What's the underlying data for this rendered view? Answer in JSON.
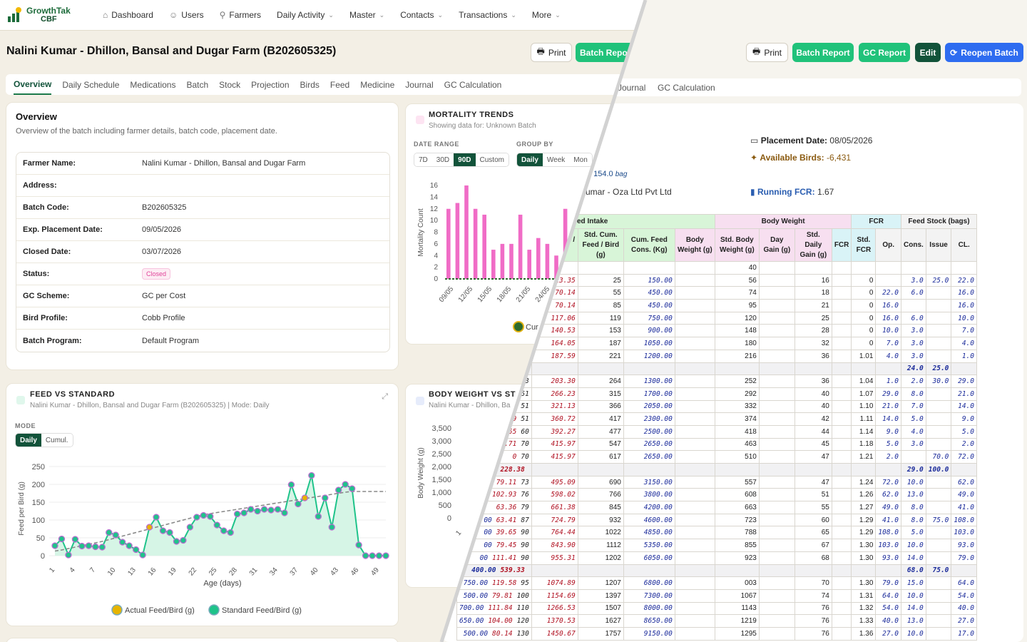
{
  "app": {
    "brand_top": "GrowthTak",
    "brand_bottom": "CBF"
  },
  "nav": [
    {
      "label": "Dashboard",
      "icon": "home-icon",
      "dropdown": false
    },
    {
      "label": "Users",
      "icon": "users-icon",
      "dropdown": false
    },
    {
      "label": "Farmers",
      "icon": "farmer-icon",
      "dropdown": false
    },
    {
      "label": "Daily Activity",
      "icon": "",
      "dropdown": true
    },
    {
      "label": "Master",
      "icon": "",
      "dropdown": true
    },
    {
      "label": "Contacts",
      "icon": "",
      "dropdown": true
    },
    {
      "label": "Transactions",
      "icon": "",
      "dropdown": true
    },
    {
      "label": "More",
      "icon": "",
      "dropdown": true
    }
  ],
  "page_title": "Nalini Kumar - Dhillon, Bansal and Dugar Farm (B202605325)",
  "buttons": {
    "print": "Print",
    "batch_report": "Batch Report",
    "batch_report_cut": "Batch Repo",
    "gc_report": "GC Report",
    "edit": "Edit",
    "reopen": "Reopen Batch"
  },
  "tabs": [
    "Overview",
    "Daily Schedule",
    "Medications",
    "Batch",
    "Stock",
    "Projection",
    "Birds",
    "Feed",
    "Medicine",
    "Journal",
    "GC Calculation"
  ],
  "right_tabs": [
    "Journal",
    "GC Calculation"
  ],
  "overview": {
    "title": "Overview",
    "subtitle": "Overview of the batch including farmer details, batch code, placement date.",
    "rows": [
      {
        "k": "Farmer Name:",
        "v": "Nalini Kumar - Dhillon, Bansal and Dugar Farm"
      },
      {
        "k": "Address:",
        "v": ""
      },
      {
        "k": "Batch Code:",
        "v": "B202605325"
      },
      {
        "k": "Exp. Placement Date:",
        "v": "09/05/2026"
      },
      {
        "k": "Closed Date:",
        "v": "03/07/2026"
      },
      {
        "k": "Status:",
        "v": "Closed"
      },
      {
        "k": "GC Scheme:",
        "v": "GC per Cost"
      },
      {
        "k": "Bird Profile:",
        "v": "Cobb Profile"
      },
      {
        "k": "Batch Program:",
        "v": "Default Program"
      }
    ]
  },
  "mortality": {
    "title": "MORTALITY TRENDS",
    "subtitle": "Showing data for: Unknown Batch",
    "date_range_label": "DATE RANGE",
    "group_by_label": "GROUP BY",
    "ranges": [
      "7D",
      "30D",
      "90D",
      "Custom"
    ],
    "groups": [
      "Daily",
      "Week",
      "Mon"
    ],
    "legend_cut": "Cur"
  },
  "feed_vs_std": {
    "title": "FEED VS STANDARD",
    "subtitle": "Nalini Kumar - Dhillon, Bansal and Dugar Farm (B202605325) | Mode: Daily",
    "mode_label": "MODE",
    "modes": [
      "Daily",
      "Cumul."
    ],
    "legend": [
      "Actual Feed/Bird (g)",
      "Standard Feed/Bird (g)"
    ]
  },
  "body_weight": {
    "title": "BODY WEIGHT VS ST",
    "subtitle": "Nalini Kumar - Dhillon, Ba"
  },
  "info": {
    "placement_label": "Placement Date:",
    "placement_value": "08/05/2026",
    "birds_label": "Available Birds:",
    "birds_value": "-6,431",
    "fcr_label": "Running FCR:",
    "fcr_value": "1.67",
    "bag_value": ": 154.0",
    "bag_unit": "bag",
    "supplier": "umar - Oza Ltd Pvt Ltd"
  },
  "chart_data": [
    {
      "type": "bar",
      "title": "MORTALITY TRENDS",
      "ylabel": "Mortality Count",
      "ylim": [
        0,
        16
      ],
      "yticks": [
        0,
        2,
        4,
        6,
        8,
        10,
        12,
        14,
        16
      ],
      "xticks": [
        "09/05",
        "12/05",
        "15/05",
        "18/05",
        "21/05",
        "24/05"
      ],
      "values": [
        12,
        13,
        16,
        12,
        11,
        5,
        6,
        6,
        11,
        5,
        7,
        6,
        4,
        12,
        7,
        6,
        9,
        9,
        8,
        13,
        6,
        8,
        12
      ],
      "color": "#f06cc6"
    },
    {
      "type": "line",
      "title": "FEED VS STANDARD",
      "xlabel": "Age (days)",
      "ylabel": "Feed per Bird (g)",
      "ylim": [
        0,
        250
      ],
      "yticks": [
        0,
        50,
        100,
        150,
        200,
        250
      ],
      "xticks": [
        "1",
        "4",
        "7",
        "10",
        "13",
        "16",
        "19",
        "22",
        "25",
        "28",
        "31",
        "34",
        "37",
        "40",
        "43",
        "46",
        "49"
      ],
      "series": [
        {
          "name": "Actual Feed/Bird (g)",
          "values": [
            28,
            47,
            2,
            46,
            27,
            28,
            25,
            24,
            65,
            58,
            38,
            28,
            17,
            2,
            80,
            108,
            70,
            65,
            40,
            43,
            80,
            108,
            113,
            110,
            86,
            70,
            65,
            117,
            120,
            130,
            125,
            130,
            128,
            130,
            120,
            199,
            145,
            162,
            225,
            110,
            162,
            80,
            184,
            200,
            188,
            30,
            0,
            0,
            0,
            0
          ]
        },
        {
          "name": "Standard Feed/Bird (g)",
          "values": [
            13,
            16,
            20,
            24,
            28,
            32,
            36,
            40,
            45,
            50,
            55,
            60,
            65,
            70,
            75,
            80,
            85,
            90,
            95,
            100,
            105,
            110,
            115,
            118,
            121,
            124,
            127,
            130,
            133,
            136,
            139,
            142,
            145,
            148,
            151,
            154,
            157,
            160,
            163,
            166,
            169,
            172,
            175,
            178,
            180,
            180,
            180,
            180,
            180,
            180
          ]
        }
      ]
    },
    {
      "type": "line",
      "title": "BODY WEIGHT VS ST",
      "ylabel": "Body Weight (g)",
      "ylim": [
        0,
        3500
      ],
      "yticks": [
        0,
        500,
        1000,
        1500,
        2000,
        2500,
        3000,
        3500
      ],
      "xticks": [
        "1"
      ]
    }
  ],
  "table": {
    "groups": [
      {
        "label": "ed Intake"
      },
      {
        "label": "Body Weight"
      },
      {
        "label": "FCR"
      },
      {
        "label": "Feed Stock (bags)"
      }
    ],
    "headers": [
      "",
      "Cum. Feed / Bird (g)",
      "Std. Cum. Feed / Bird (g)",
      "Cum. Feed Cons. (Kg)",
      "Body Weight (g)",
      "Std. Body Weight (g)",
      "Day Gain (g)",
      "Std. Daily Gain (g)",
      "FCR",
      "Std. FCR",
      "Op.",
      "Cons.",
      "Issue",
      "CL."
    ],
    "rows": [
      {
        "c": [
          "",
          "",
          "",
          "",
          "",
          "40",
          "",
          "",
          "",
          "",
          "",
          "",
          "",
          ""
        ]
      },
      {
        "c": [
          "",
          "23.35",
          "25",
          "150.00",
          "",
          "56",
          "",
          "16",
          "",
          "0",
          "",
          "3.0",
          "25.0",
          "22.0"
        ]
      },
      {
        "c": [
          "30",
          "70.14",
          "55",
          "450.00",
          "",
          "74",
          "",
          "18",
          "",
          "0",
          "22.0",
          "6.0",
          "",
          "16.0"
        ]
      },
      {
        "c": [
          "30",
          "70.14",
          "85",
          "450.00",
          "",
          "95",
          "",
          "21",
          "",
          "0",
          "16.0",
          "",
          "",
          "16.0"
        ]
      },
      {
        "c": [
          "34",
          "117.06",
          "119",
          "750.00",
          "",
          "120",
          "",
          "25",
          "",
          "0",
          "16.0",
          "6.0",
          "",
          "10.0"
        ]
      },
      {
        "c": [
          "34",
          "140.53",
          "153",
          "900.00",
          "",
          "148",
          "",
          "28",
          "",
          "0",
          "10.0",
          "3.0",
          "",
          "7.0"
        ]
      },
      {
        "c": [
          "34",
          "164.05",
          "187",
          "1050.00",
          "",
          "180",
          "",
          "32",
          "",
          "0",
          "7.0",
          "3.0",
          "",
          "4.0"
        ]
      },
      {
        "c": [
          "34",
          "187.59",
          "221",
          "1200.00",
          "",
          "216",
          "",
          "36",
          "",
          "1.01",
          "4.0",
          "3.0",
          "",
          "1.0"
        ]
      },
      {
        "sub": true,
        "c": [
          "",
          "",
          "",
          "",
          "",
          "",
          "",
          "",
          "",
          "",
          "",
          "24.0",
          "25.0",
          ""
        ]
      },
      {
        "c": [
          "43",
          "203.30",
          "264",
          "1300.00",
          "",
          "252",
          "",
          "36",
          "",
          "1.04",
          "1.0",
          "2.0",
          "30.0",
          "29.0"
        ]
      },
      {
        "c": [
          "51",
          "266.23",
          "315",
          "1700.00",
          "",
          "292",
          "",
          "40",
          "",
          "1.07",
          "29.0",
          "8.0",
          "",
          "21.0"
        ]
      },
      {
        "c": [
          "51",
          "321.13",
          "366",
          "2050.00",
          "",
          "332",
          "",
          "40",
          "",
          "1.10",
          "21.0",
          "7.0",
          "",
          "14.0"
        ]
      },
      {
        "c": [
          "51",
          "360.72",
          "417",
          "2300.00",
          "",
          "374",
          "",
          "42",
          "",
          "1.11",
          "14.0",
          "5.0",
          "",
          "9.0"
        ]
      },
      {
        "c": [
          "60",
          "392.27",
          "477",
          "2500.00",
          "",
          "418",
          "",
          "44",
          "",
          "1.14",
          "9.0",
          "4.0",
          "",
          "5.0"
        ]
      },
      {
        "c": [
          "70",
          "415.97",
          "547",
          "2650.00",
          "",
          "463",
          "",
          "45",
          "",
          "1.18",
          "5.0",
          "3.0",
          "",
          "2.0"
        ]
      },
      {
        "c": [
          "70",
          "415.97",
          "617",
          "2650.00",
          "",
          "510",
          "",
          "47",
          "",
          "1.21",
          "2.0",
          "",
          "70.0",
          "72.0"
        ]
      },
      {
        "sub": true,
        "c": [
          "",
          "",
          "",
          "",
          "",
          "",
          "",
          "",
          "",
          "",
          "",
          "29.0",
          "100.0",
          ""
        ]
      },
      {
        "c": [
          "73",
          "495.09",
          "690",
          "3150.00",
          "",
          "557",
          "",
          "47",
          "",
          "1.24",
          "72.0",
          "10.0",
          "",
          "62.0"
        ]
      },
      {
        "c": [
          "76",
          "598.02",
          "766",
          "3800.00",
          "",
          "608",
          "",
          "51",
          "",
          "1.26",
          "62.0",
          "13.0",
          "",
          "49.0"
        ]
      },
      {
        "c": [
          "79",
          "661.38",
          "845",
          "4200.00",
          "",
          "663",
          "",
          "55",
          "",
          "1.27",
          "49.0",
          "8.0",
          "",
          "41.0"
        ]
      },
      {
        "c": [
          "87",
          "724.79",
          "932",
          "4600.00",
          "",
          "723",
          "",
          "60",
          "",
          "1.29",
          "41.0",
          "8.0",
          "75.0",
          "108.0"
        ]
      },
      {
        "c": [
          "90",
          "764.44",
          "1022",
          "4850.00",
          "",
          "788",
          "",
          "65",
          "",
          "1.29",
          "108.0",
          "5.0",
          "",
          "103.0"
        ]
      },
      {
        "c": [
          "90",
          "843.90",
          "1112",
          "5350.00",
          "",
          "855",
          "",
          "67",
          "",
          "1.30",
          "103.0",
          "10.0",
          "",
          "93.0"
        ]
      },
      {
        "c": [
          "90",
          "955.31",
          "1202",
          "6050.00",
          "",
          "923",
          "",
          "68",
          "",
          "1.30",
          "93.0",
          "14.0",
          "",
          "79.0"
        ]
      },
      {
        "sub": true,
        "c": [
          "",
          "",
          "",
          "",
          "",
          "",
          "",
          "",
          "",
          "",
          "",
          "68.0",
          "75.0",
          ""
        ]
      },
      {
        "c": [
          "95",
          "1074.89",
          "1207",
          "6800.00",
          "",
          "003",
          "",
          "70",
          "",
          "1.30",
          "79.0",
          "15.0",
          "",
          "64.0"
        ]
      },
      {
        "c": [
          "100",
          "1154.69",
          "1397",
          "7300.00",
          "",
          "1067",
          "",
          "74",
          "",
          "1.31",
          "64.0",
          "10.0",
          "",
          "54.0"
        ]
      },
      {
        "c": [
          "110",
          "1266.53",
          "1507",
          "8000.00",
          "",
          "1143",
          "",
          "76",
          "",
          "1.32",
          "54.0",
          "14.0",
          "",
          "40.0"
        ]
      },
      {
        "c": [
          "120",
          "1370.53",
          "1627",
          "8650.00",
          "",
          "1219",
          "",
          "76",
          "",
          "1.33",
          "40.0",
          "13.0",
          "",
          "27.0"
        ]
      },
      {
        "c": [
          "130",
          "1450.67",
          "1757",
          "9150.00",
          "",
          "1295",
          "",
          "76",
          "",
          "1.36",
          "27.0",
          "10.0",
          "",
          "17.0"
        ]
      }
    ],
    "left_edge": [
      "",
      "",
      "",
      "",
      "",
      "",
      "",
      "",
      "",
      "",
      "92",
      "10",
      "39",
      "1.55",
      "23.71",
      "0",
      "228.38",
      "79.11",
      "102.93",
      "63.36",
      "63.41",
      "39.65",
      "79.45",
      "111.41",
      "539.33",
      "119.58",
      "79.81",
      "111.84",
      "104.00",
      "80.14"
    ],
    "left_edge2": [
      "",
      "",
      "",
      "",
      "",
      "",
      "",
      "",
      "",
      "",
      "",
      "",
      "",
      "",
      "",
      "",
      "",
      "",
      "",
      "",
      "00",
      "00",
      "00",
      "00",
      "400.00",
      "750.00",
      "500.00",
      "700.00",
      "650.00",
      "500.00"
    ]
  }
}
